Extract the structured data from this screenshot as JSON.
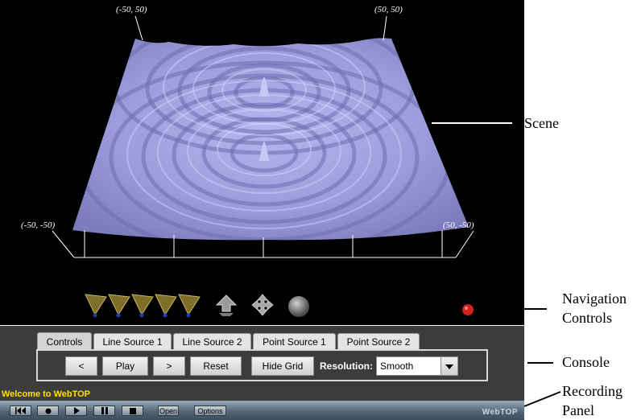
{
  "scene": {
    "corners": {
      "top_left": "(-50, 50)",
      "top_right": "(50, 50)",
      "bottom_left": "(-50, -50)",
      "bottom_right": "(50, -50)"
    }
  },
  "nav_icons": [
    "camera-view-icon",
    "camera-view-icon",
    "camera-view-icon",
    "camera-view-icon",
    "camera-view-icon",
    "pan-up-down-icon",
    "move-arrows-icon",
    "sphere-examine-icon",
    "red-dot-icon"
  ],
  "annotations": {
    "scene": "Scene",
    "navigation": [
      "Navigation",
      "Controls"
    ],
    "console": "Console",
    "recording": [
      "Recording",
      "Panel"
    ]
  },
  "console": {
    "tabs": [
      "Controls",
      "Line Source 1",
      "Line Source 2",
      "Point Source 1",
      "Point Source 2"
    ],
    "active_tab": "Controls",
    "buttons": [
      "<",
      "Play",
      ">",
      "Reset",
      "Hide Grid"
    ],
    "resolution_label": "Resolution:",
    "resolution_value": "Smooth",
    "status": "Welcome to WebTOP"
  },
  "recording": {
    "buttons": [
      "|◀◀",
      "●",
      "▶",
      "❚❚",
      "■"
    ],
    "open_label": "Open",
    "options_label": "Options",
    "logo": "WebTOP"
  },
  "colors": {
    "surface": "#9a9ad8",
    "status_text": "#ffe000",
    "record_dot": "#d32020"
  }
}
